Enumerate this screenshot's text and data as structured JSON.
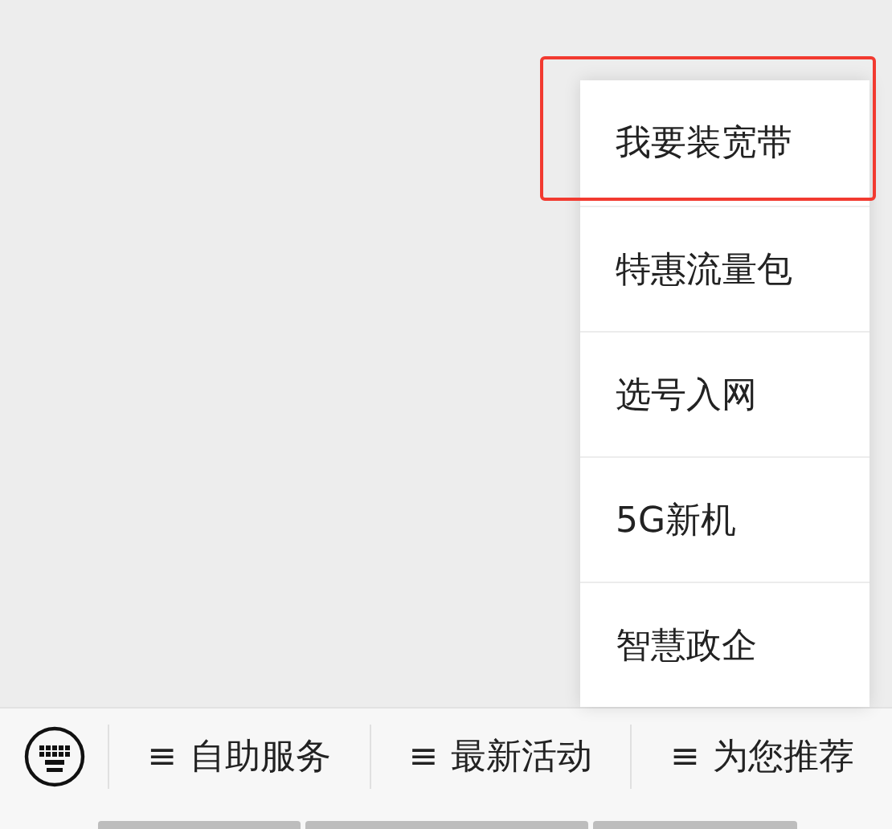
{
  "popup_menu": {
    "items": [
      {
        "label": "我要装宽带",
        "highlighted": true
      },
      {
        "label": "特惠流量包",
        "highlighted": false
      },
      {
        "label": "选号入网",
        "highlighted": false
      },
      {
        "label": "5G新机",
        "highlighted": false
      },
      {
        "label": "智慧政企",
        "highlighted": false
      }
    ]
  },
  "bottom_menu": {
    "items": [
      {
        "icon": "≡",
        "label": "自助服务"
      },
      {
        "icon": "≡",
        "label": "最新活动"
      },
      {
        "icon": "≡",
        "label": "为您推荐"
      }
    ]
  }
}
